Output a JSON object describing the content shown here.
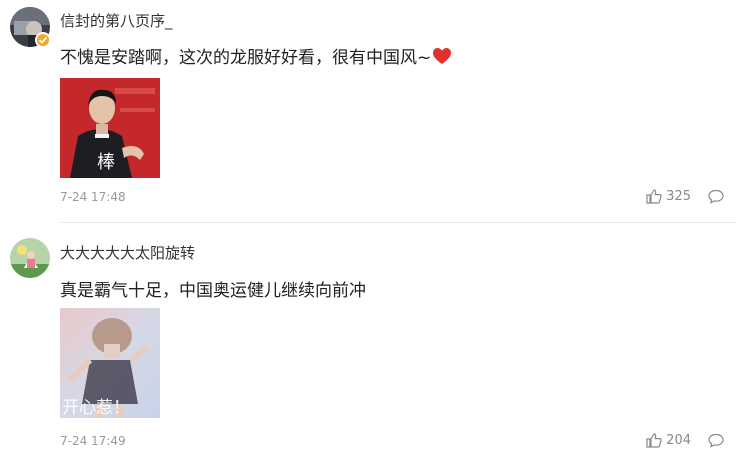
{
  "comments": [
    {
      "username": "信封的第八页序_",
      "text": "不愧是安踏啊，这次的龙服好好看，很有中国风~",
      "image_caption": "棒",
      "time": "7-24 17:48",
      "likes": "325",
      "verified": true,
      "icons": {
        "like": "thumbs-up-icon",
        "reply": "comment-bubble-icon",
        "emoji": "heart-emoji",
        "badge": "verified-badge-icon"
      }
    },
    {
      "username": "大大大大大太阳旋转",
      "text": "真是霸气十足，中国奥运健儿继续向前冲",
      "image_caption": "开心惹！",
      "time": "7-24 17:49",
      "likes": "204",
      "verified": false,
      "icons": {
        "like": "thumbs-up-icon",
        "reply": "comment-bubble-icon"
      }
    }
  ],
  "colors": {
    "verified_badge": "#f5a623",
    "heart": "#e0312f",
    "meta_text": "#999999"
  }
}
